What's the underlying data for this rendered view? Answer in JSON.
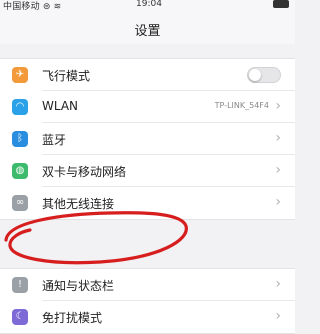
{
  "status_bar": {
    "carrier": "中国移动 ⊜ ≋",
    "time": "19:04"
  },
  "header": {
    "title": "设置"
  },
  "groups": [
    {
      "items": [
        {
          "label": "飞行模式",
          "icon": "airplane-icon",
          "icon_color": "#f39b3a",
          "control": "toggle",
          "toggle_on": false
        },
        {
          "label": "WLAN",
          "icon": "wifi-icon",
          "icon_color": "#2aa1e8",
          "value": "TP-LINK_54F4",
          "control": "chevron"
        },
        {
          "label": "蓝牙",
          "icon": "bluetooth-icon",
          "icon_color": "#2a8ee0",
          "control": "chevron"
        },
        {
          "label": "双卡与移动网络",
          "icon": "globe-icon",
          "icon_color": "#3dbb6c",
          "control": "chevron"
        },
        {
          "label": "其他无线连接",
          "icon": "link-icon",
          "icon_color": "#9aa0a6",
          "control": "chevron"
        }
      ]
    },
    {
      "items": [
        {
          "label": "通知与状态栏",
          "icon": "notification-icon",
          "icon_color": "#9aa0a6",
          "control": "chevron"
        },
        {
          "label": "免打扰模式",
          "icon": "moon-icon",
          "icon_color": "#7d6ad6",
          "control": "chevron"
        }
      ]
    }
  ],
  "annotation": {
    "type": "hand-drawn circle",
    "color": "#d71e1e",
    "target": "其他无线连接"
  },
  "colors": {
    "background": "#f2f2f4",
    "row_bg": "#ffffff",
    "chevron": "#b0b0b4"
  }
}
